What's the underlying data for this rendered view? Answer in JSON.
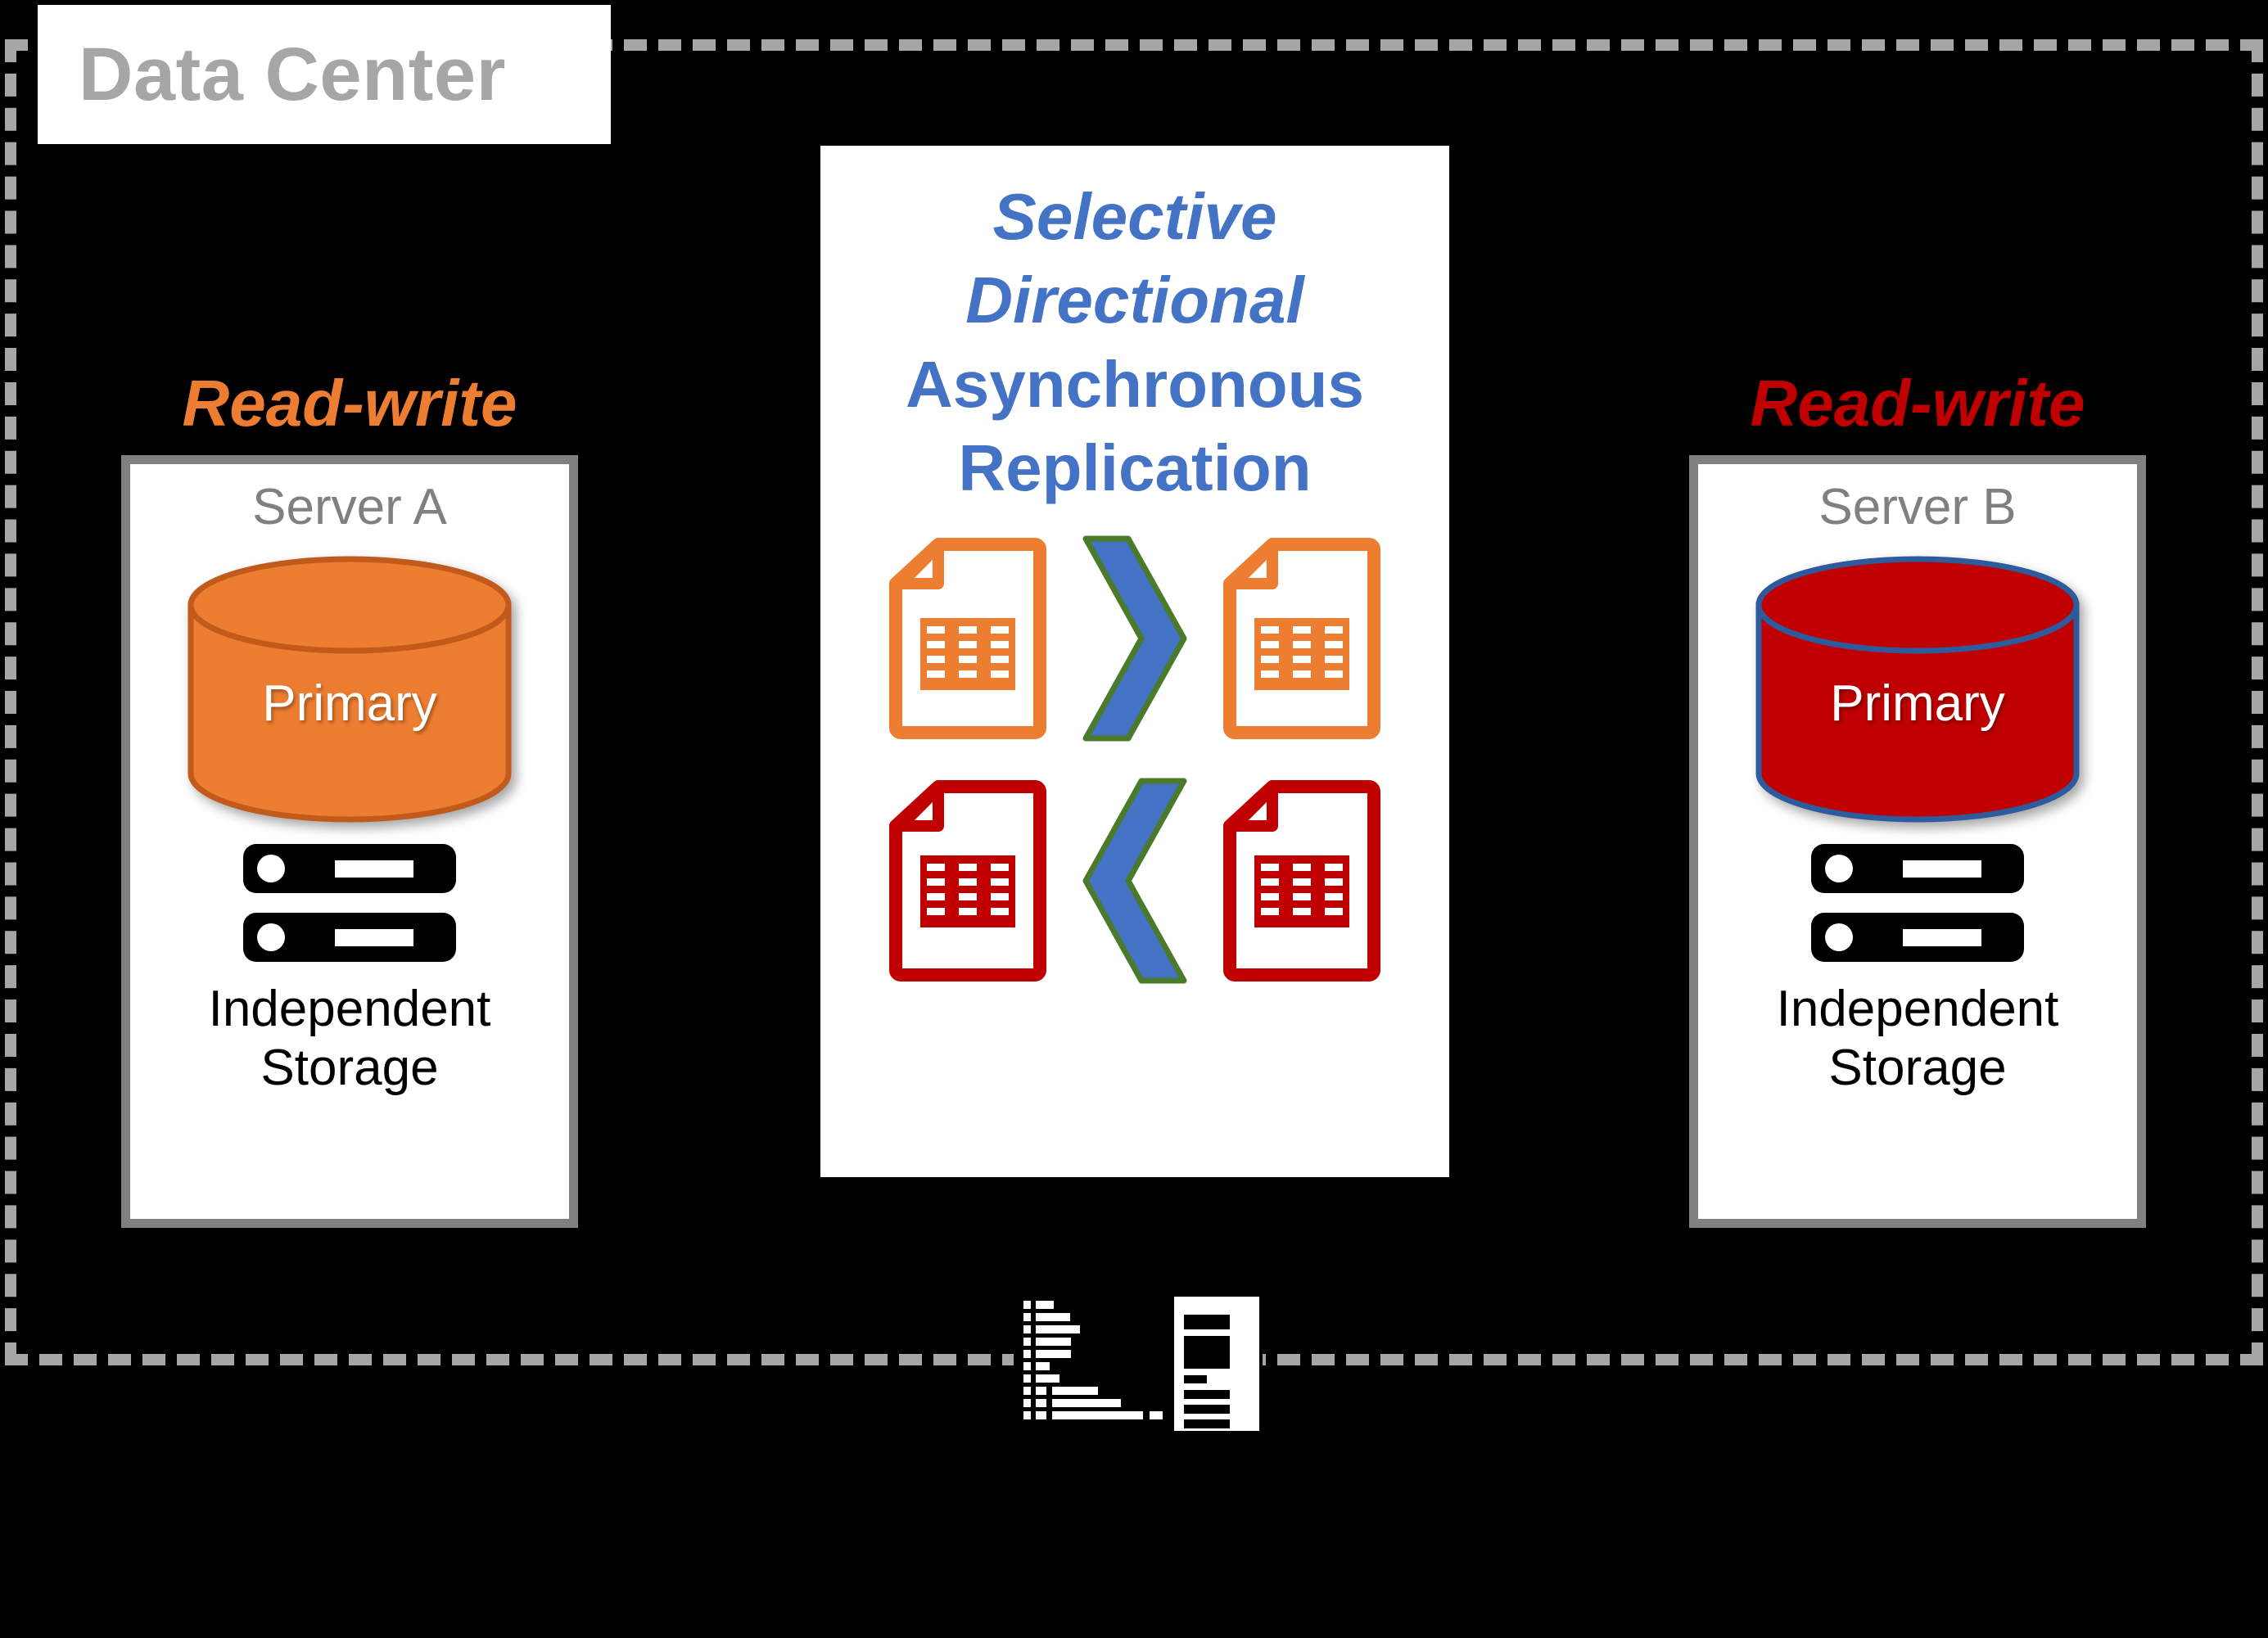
{
  "diagram": {
    "background_color": "#000000",
    "boundary": {
      "label": "Data Center",
      "label_color": "#a6a6a6",
      "border_color": "#a6a6a6",
      "border_style": "dashed"
    },
    "servers": [
      {
        "access_label": "Read-write",
        "access_color": "#ED7D31",
        "title": "Server A",
        "database_label": "Primary",
        "database_fill": "#ED7D31",
        "database_stroke": "#C15A1B",
        "storage_label_line1": "Independent",
        "storage_label_line2": "Storage",
        "rack_icon": "server-rack-icon"
      },
      {
        "access_label": "Read-write",
        "access_color": "#C00000",
        "title": "Server B",
        "database_label": "Primary",
        "database_fill": "#C00000",
        "database_stroke": "#2E5B9E",
        "storage_label_line1": "Independent",
        "storage_label_line2": "Storage",
        "rack_icon": "server-rack-icon"
      }
    ],
    "replication": {
      "accent_color": "#4472C4",
      "title_lines": [
        {
          "text": "Selective",
          "style": "bold-italic"
        },
        {
          "text": "Directional",
          "style": "bold-italic"
        },
        {
          "text": "Asynchronous",
          "style": "bold"
        },
        {
          "text": "Replication",
          "style": "bold"
        }
      ],
      "flows": [
        {
          "direction": "left-to-right",
          "color": "#ED7D31",
          "source_icon": "document-table-icon",
          "arrow_icon": "chevron-right-icon",
          "target_icon": "document-table-icon",
          "arrow_fill": "#4472C4",
          "arrow_stroke": "#4A7A2A"
        },
        {
          "direction": "right-to-left",
          "color": "#C00000",
          "source_icon": "document-table-icon",
          "arrow_icon": "chevron-left-icon",
          "target_icon": "document-table-icon",
          "arrow_fill": "#4472C4",
          "arrow_stroke": "#4A7A2A"
        }
      ]
    },
    "network_icon": {
      "name": "analytics-report-icon"
    }
  }
}
